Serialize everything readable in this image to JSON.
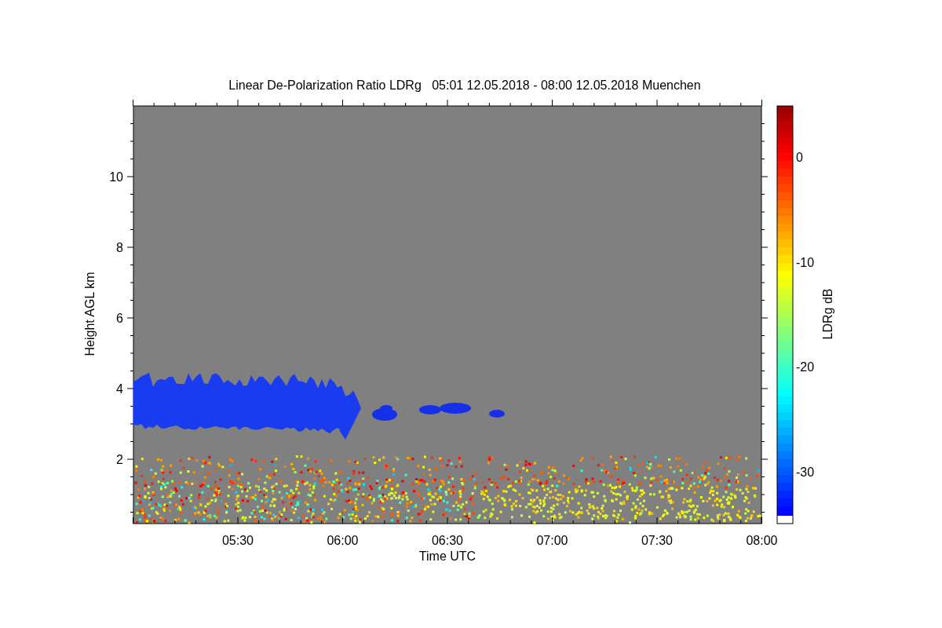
{
  "title": "Linear De-Polarization Ratio LDRg   05:01 12.05.2018 - 08:00 12.05.2018 Muenchen",
  "xlabel": "Time UTC",
  "ylabel": "Height AGL km",
  "xticks": [
    "05:30",
    "06:00",
    "06:30",
    "07:00",
    "07:30",
    "08:00"
  ],
  "yticks": [
    "10",
    "8",
    "6",
    "4",
    "2"
  ],
  "colorbar": {
    "label": "LDRg dB",
    "ticks": [
      "0",
      "-10",
      "-20",
      "-30"
    ]
  }
}
